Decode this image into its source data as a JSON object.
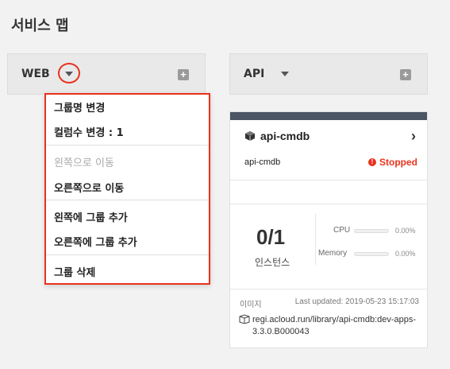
{
  "page": {
    "title": "서비스 맵"
  },
  "groups": [
    {
      "name": "WEB",
      "add_icon": "plus-square-icon"
    },
    {
      "name": "API",
      "add_icon": "plus-square-icon"
    }
  ],
  "menu": {
    "items": [
      {
        "label": "그룹명 변경",
        "enabled": true
      },
      {
        "label": "컬럼수 변경 : 1",
        "enabled": true
      },
      {
        "label": "왼쪽으로 이동",
        "enabled": false
      },
      {
        "label": "오른쪽으로 이동",
        "enabled": true
      },
      {
        "label": "왼쪽에 그룹 추가",
        "enabled": true
      },
      {
        "label": "오른쪽에 그룹 추가",
        "enabled": true
      },
      {
        "label": "그룹 삭제",
        "enabled": true
      }
    ]
  },
  "card": {
    "title": "api-cmdb",
    "subtitle": "api-cmdb",
    "status": "Stopped",
    "status_color": "#e8321e",
    "instances": "0/1",
    "instances_label": "인스턴스",
    "metrics": [
      {
        "label": "CPU",
        "value": "0.00%"
      },
      {
        "label": "Memory",
        "value": "0.00%"
      }
    ],
    "image_label": "이미지",
    "last_updated": "Last updated: 2019-05-23 15:17:03",
    "image_path": "regi.acloud.run/library/api-cmdb:dev-apps-3.3.0.B000043"
  },
  "colors": {
    "highlight": "#e8321e",
    "card_top": "#4b5563"
  }
}
